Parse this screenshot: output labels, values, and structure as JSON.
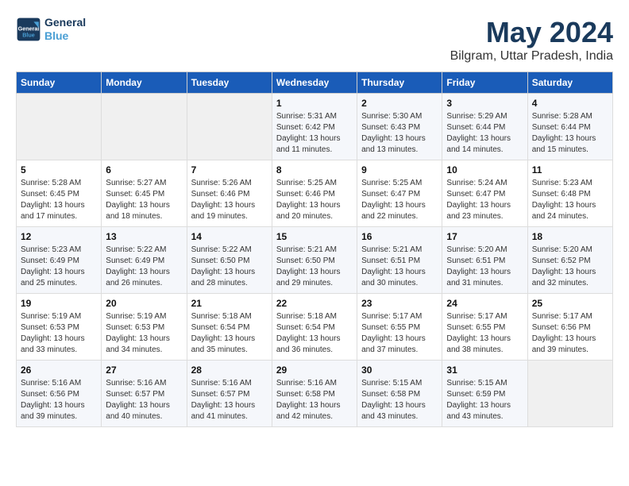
{
  "logo": {
    "line1": "General",
    "line2": "Blue"
  },
  "title": "May 2024",
  "subtitle": "Bilgram, Uttar Pradesh, India",
  "colors": {
    "header_bg": "#1a5cb8",
    "accent": "#1a3a5c"
  },
  "days_of_week": [
    "Sunday",
    "Monday",
    "Tuesday",
    "Wednesday",
    "Thursday",
    "Friday",
    "Saturday"
  ],
  "weeks": [
    [
      {
        "day": "",
        "info": ""
      },
      {
        "day": "",
        "info": ""
      },
      {
        "day": "",
        "info": ""
      },
      {
        "day": "1",
        "info": "Sunrise: 5:31 AM\nSunset: 6:42 PM\nDaylight: 13 hours\nand 11 minutes."
      },
      {
        "day": "2",
        "info": "Sunrise: 5:30 AM\nSunset: 6:43 PM\nDaylight: 13 hours\nand 13 minutes."
      },
      {
        "day": "3",
        "info": "Sunrise: 5:29 AM\nSunset: 6:44 PM\nDaylight: 13 hours\nand 14 minutes."
      },
      {
        "day": "4",
        "info": "Sunrise: 5:28 AM\nSunset: 6:44 PM\nDaylight: 13 hours\nand 15 minutes."
      }
    ],
    [
      {
        "day": "5",
        "info": "Sunrise: 5:28 AM\nSunset: 6:45 PM\nDaylight: 13 hours\nand 17 minutes."
      },
      {
        "day": "6",
        "info": "Sunrise: 5:27 AM\nSunset: 6:45 PM\nDaylight: 13 hours\nand 18 minutes."
      },
      {
        "day": "7",
        "info": "Sunrise: 5:26 AM\nSunset: 6:46 PM\nDaylight: 13 hours\nand 19 minutes."
      },
      {
        "day": "8",
        "info": "Sunrise: 5:25 AM\nSunset: 6:46 PM\nDaylight: 13 hours\nand 20 minutes."
      },
      {
        "day": "9",
        "info": "Sunrise: 5:25 AM\nSunset: 6:47 PM\nDaylight: 13 hours\nand 22 minutes."
      },
      {
        "day": "10",
        "info": "Sunrise: 5:24 AM\nSunset: 6:47 PM\nDaylight: 13 hours\nand 23 minutes."
      },
      {
        "day": "11",
        "info": "Sunrise: 5:23 AM\nSunset: 6:48 PM\nDaylight: 13 hours\nand 24 minutes."
      }
    ],
    [
      {
        "day": "12",
        "info": "Sunrise: 5:23 AM\nSunset: 6:49 PM\nDaylight: 13 hours\nand 25 minutes."
      },
      {
        "day": "13",
        "info": "Sunrise: 5:22 AM\nSunset: 6:49 PM\nDaylight: 13 hours\nand 26 minutes."
      },
      {
        "day": "14",
        "info": "Sunrise: 5:22 AM\nSunset: 6:50 PM\nDaylight: 13 hours\nand 28 minutes."
      },
      {
        "day": "15",
        "info": "Sunrise: 5:21 AM\nSunset: 6:50 PM\nDaylight: 13 hours\nand 29 minutes."
      },
      {
        "day": "16",
        "info": "Sunrise: 5:21 AM\nSunset: 6:51 PM\nDaylight: 13 hours\nand 30 minutes."
      },
      {
        "day": "17",
        "info": "Sunrise: 5:20 AM\nSunset: 6:51 PM\nDaylight: 13 hours\nand 31 minutes."
      },
      {
        "day": "18",
        "info": "Sunrise: 5:20 AM\nSunset: 6:52 PM\nDaylight: 13 hours\nand 32 minutes."
      }
    ],
    [
      {
        "day": "19",
        "info": "Sunrise: 5:19 AM\nSunset: 6:53 PM\nDaylight: 13 hours\nand 33 minutes."
      },
      {
        "day": "20",
        "info": "Sunrise: 5:19 AM\nSunset: 6:53 PM\nDaylight: 13 hours\nand 34 minutes."
      },
      {
        "day": "21",
        "info": "Sunrise: 5:18 AM\nSunset: 6:54 PM\nDaylight: 13 hours\nand 35 minutes."
      },
      {
        "day": "22",
        "info": "Sunrise: 5:18 AM\nSunset: 6:54 PM\nDaylight: 13 hours\nand 36 minutes."
      },
      {
        "day": "23",
        "info": "Sunrise: 5:17 AM\nSunset: 6:55 PM\nDaylight: 13 hours\nand 37 minutes."
      },
      {
        "day": "24",
        "info": "Sunrise: 5:17 AM\nSunset: 6:55 PM\nDaylight: 13 hours\nand 38 minutes."
      },
      {
        "day": "25",
        "info": "Sunrise: 5:17 AM\nSunset: 6:56 PM\nDaylight: 13 hours\nand 39 minutes."
      }
    ],
    [
      {
        "day": "26",
        "info": "Sunrise: 5:16 AM\nSunset: 6:56 PM\nDaylight: 13 hours\nand 39 minutes."
      },
      {
        "day": "27",
        "info": "Sunrise: 5:16 AM\nSunset: 6:57 PM\nDaylight: 13 hours\nand 40 minutes."
      },
      {
        "day": "28",
        "info": "Sunrise: 5:16 AM\nSunset: 6:57 PM\nDaylight: 13 hours\nand 41 minutes."
      },
      {
        "day": "29",
        "info": "Sunrise: 5:16 AM\nSunset: 6:58 PM\nDaylight: 13 hours\nand 42 minutes."
      },
      {
        "day": "30",
        "info": "Sunrise: 5:15 AM\nSunset: 6:58 PM\nDaylight: 13 hours\nand 43 minutes."
      },
      {
        "day": "31",
        "info": "Sunrise: 5:15 AM\nSunset: 6:59 PM\nDaylight: 13 hours\nand 43 minutes."
      },
      {
        "day": "",
        "info": ""
      }
    ]
  ]
}
